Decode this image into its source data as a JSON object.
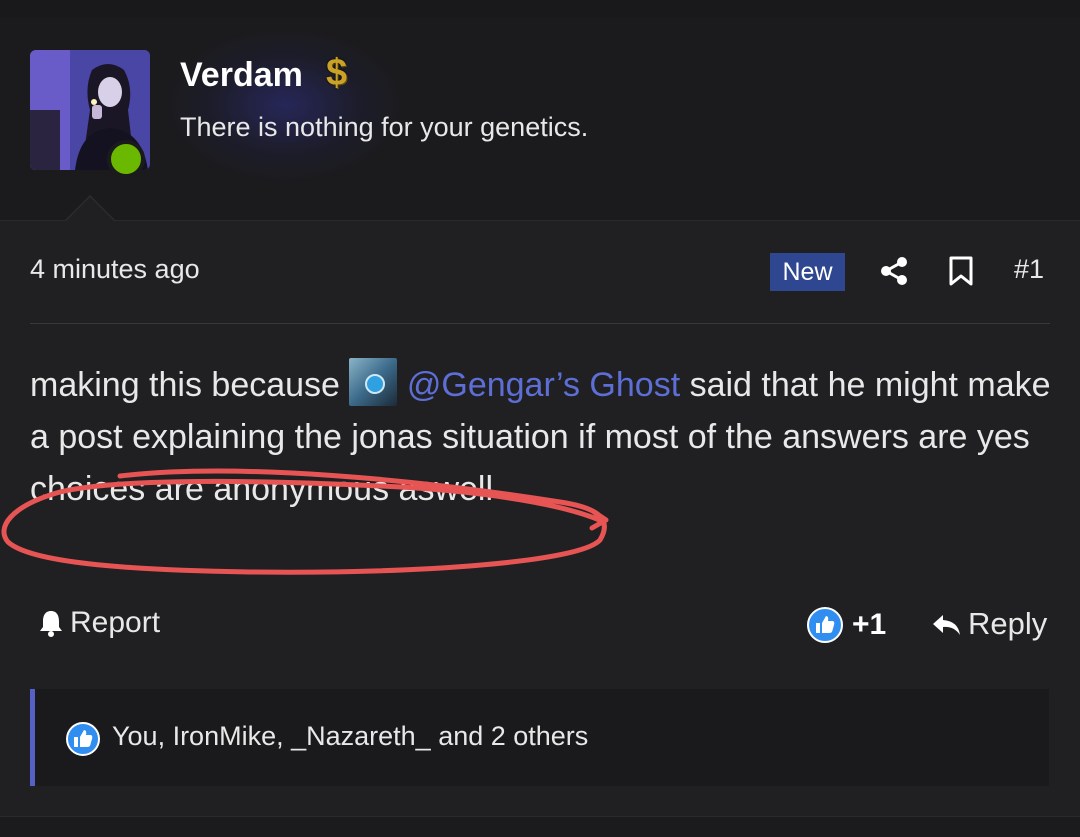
{
  "user": {
    "username": "Verdam",
    "title": "There is nothing for your genetics.",
    "status": "online",
    "badge_icon": "dollar-icon",
    "badge_color": "#c9a227"
  },
  "post": {
    "timestamp": "4 minutes ago",
    "new_label": "New",
    "number": "#1",
    "text_before_mention": "making this because ",
    "mention": "@Gengar’s Ghost",
    "text_after_mention": " said that he might make a post explaining the jonas situation if most of the answers are yes",
    "line_two": "choices are anonymous aswell"
  },
  "actions": {
    "report_label": "Report",
    "like_count": "+1",
    "reply_label": "Reply"
  },
  "reactions": {
    "summary": "You, IronMike, _Nazareth_ and 2 others"
  },
  "colors": {
    "accent": "#5661c8",
    "mention": "#5d6fd6",
    "new_badge": "#2e4790",
    "online": "#6bb800",
    "annotation": "#e65454",
    "like": "#2f8ef0"
  }
}
